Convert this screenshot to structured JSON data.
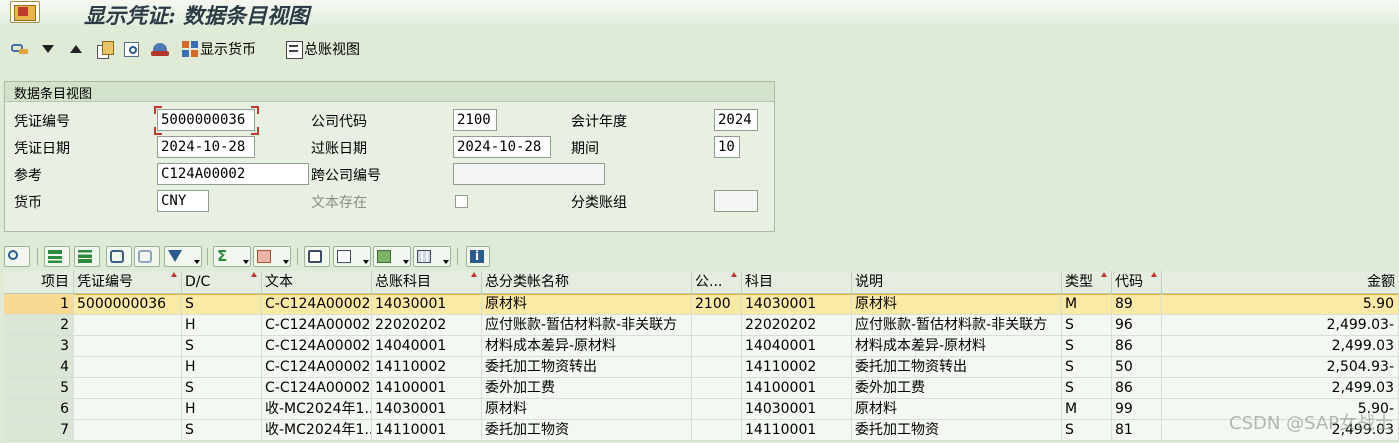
{
  "title": "显示凭证: 数据条目视图",
  "toolbar": {
    "show_currency_label": "显示货币",
    "gl_view_label": "总账视图"
  },
  "panel": {
    "title": "数据条目视图",
    "doc_no_label": "凭证编号",
    "doc_no_value": "5000000036",
    "company_code_label": "公司代码",
    "company_code_value": "2100",
    "fiscal_year_label": "会计年度",
    "fiscal_year_value": "2024",
    "doc_date_label": "凭证日期",
    "doc_date_value": "2024-10-28",
    "posting_date_label": "过账日期",
    "posting_date_value": "2024-10-28",
    "period_label": "期间",
    "period_value": "10",
    "reference_label": "参考",
    "reference_value": "C124A00002",
    "cross_cc_label": "跨公司编号",
    "cross_cc_value": "",
    "currency_label": "货币",
    "currency_value": "CNY",
    "text_exists_label": "文本存在",
    "ledger_group_label": "分类账组",
    "ledger_group_value": ""
  },
  "grid": {
    "columns": [
      "项目",
      "凭证编号",
      "D/C",
      "文本",
      "总账科目",
      "总分类帐名称",
      "公...",
      "科目",
      "说明",
      "类型",
      "代码",
      "金额"
    ],
    "rows": [
      [
        "1",
        "5000000036",
        "S",
        "C-C124A00002...",
        "14030001",
        "原材料",
        "2100",
        "14030001",
        "原材料",
        "M",
        "89",
        "5.90"
      ],
      [
        "2",
        "",
        "H",
        "C-C124A00002...",
        "22020202",
        "应付账款-暂估材料款-非关联方",
        "",
        "22020202",
        "应付账款-暂估材料款-非关联方",
        "S",
        "96",
        "2,499.03-"
      ],
      [
        "3",
        "",
        "S",
        "C-C124A00002...",
        "14040001",
        "材料成本差异-原材料",
        "",
        "14040001",
        "材料成本差异-原材料",
        "S",
        "86",
        "2,499.03"
      ],
      [
        "4",
        "",
        "H",
        "C-C124A00002...",
        "14110002",
        "委托加工物资转出",
        "",
        "14110002",
        "委托加工物资转出",
        "S",
        "50",
        "2,504.93-"
      ],
      [
        "5",
        "",
        "S",
        "C-C124A00002...",
        "14100001",
        "委外加工费",
        "",
        "14100001",
        "委外加工费",
        "S",
        "86",
        "2,499.03"
      ],
      [
        "6",
        "",
        "H",
        "收-MC2024年1...",
        "14030001",
        "原材料",
        "",
        "14030001",
        "原材料",
        "M",
        "99",
        "5.90-"
      ],
      [
        "7",
        "",
        "S",
        "收-MC2024年1...",
        "14110001",
        "委托加工物资",
        "",
        "14110001",
        "委托加工物资",
        "S",
        "81",
        "2,499.03"
      ]
    ]
  },
  "watermark": "CSDN @SAP女战士",
  "colors": {
    "background": "#dfebd7",
    "selected_row": "#fde9a6",
    "title_text": "#2d3c44"
  }
}
